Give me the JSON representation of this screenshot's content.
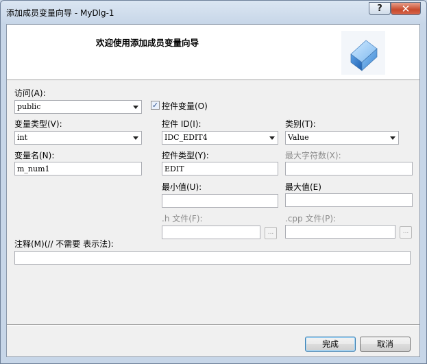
{
  "window": {
    "title": "添加成员变量向导 - MyDlg-1",
    "help_glyph": "?",
    "close_glyph": "✕"
  },
  "banner": {
    "title": "欢迎使用添加成员变量向导",
    "art_icon": "3d-cube-icon"
  },
  "access": {
    "label": "访问(A):",
    "value": "public"
  },
  "control_var": {
    "label": "控件变量(O)",
    "checked": true,
    "check_glyph": "✓"
  },
  "var_type": {
    "label": "变量类型(V):",
    "value": "int"
  },
  "control_id": {
    "label": "控件 ID(I):",
    "value": "IDC_EDIT4"
  },
  "category": {
    "label": "类别(T):",
    "value": "Value"
  },
  "var_name": {
    "label": "变量名(N):",
    "value": "m_num1"
  },
  "control_type": {
    "label": "控件类型(Y):",
    "value": "EDIT"
  },
  "max_chars": {
    "label": "最大字符数(X):",
    "value": ""
  },
  "min_value": {
    "label": "最小值(U):",
    "value": ""
  },
  "max_value": {
    "label": "最大值(E)",
    "value": ""
  },
  "h_file": {
    "label": ".h 文件(F):",
    "value": "",
    "browse_label": "..."
  },
  "cpp_file": {
    "label": ".cpp 文件(P):",
    "value": "",
    "browse_label": "..."
  },
  "comment": {
    "label": "注释(M)(// 不需要 表示法):",
    "value": ""
  },
  "buttons": {
    "finish": "完成",
    "cancel": "取消"
  },
  "colors": {
    "accent": "#3c7fb1",
    "close": "#c74a2c",
    "disabled_text": "#8c8c8c"
  }
}
